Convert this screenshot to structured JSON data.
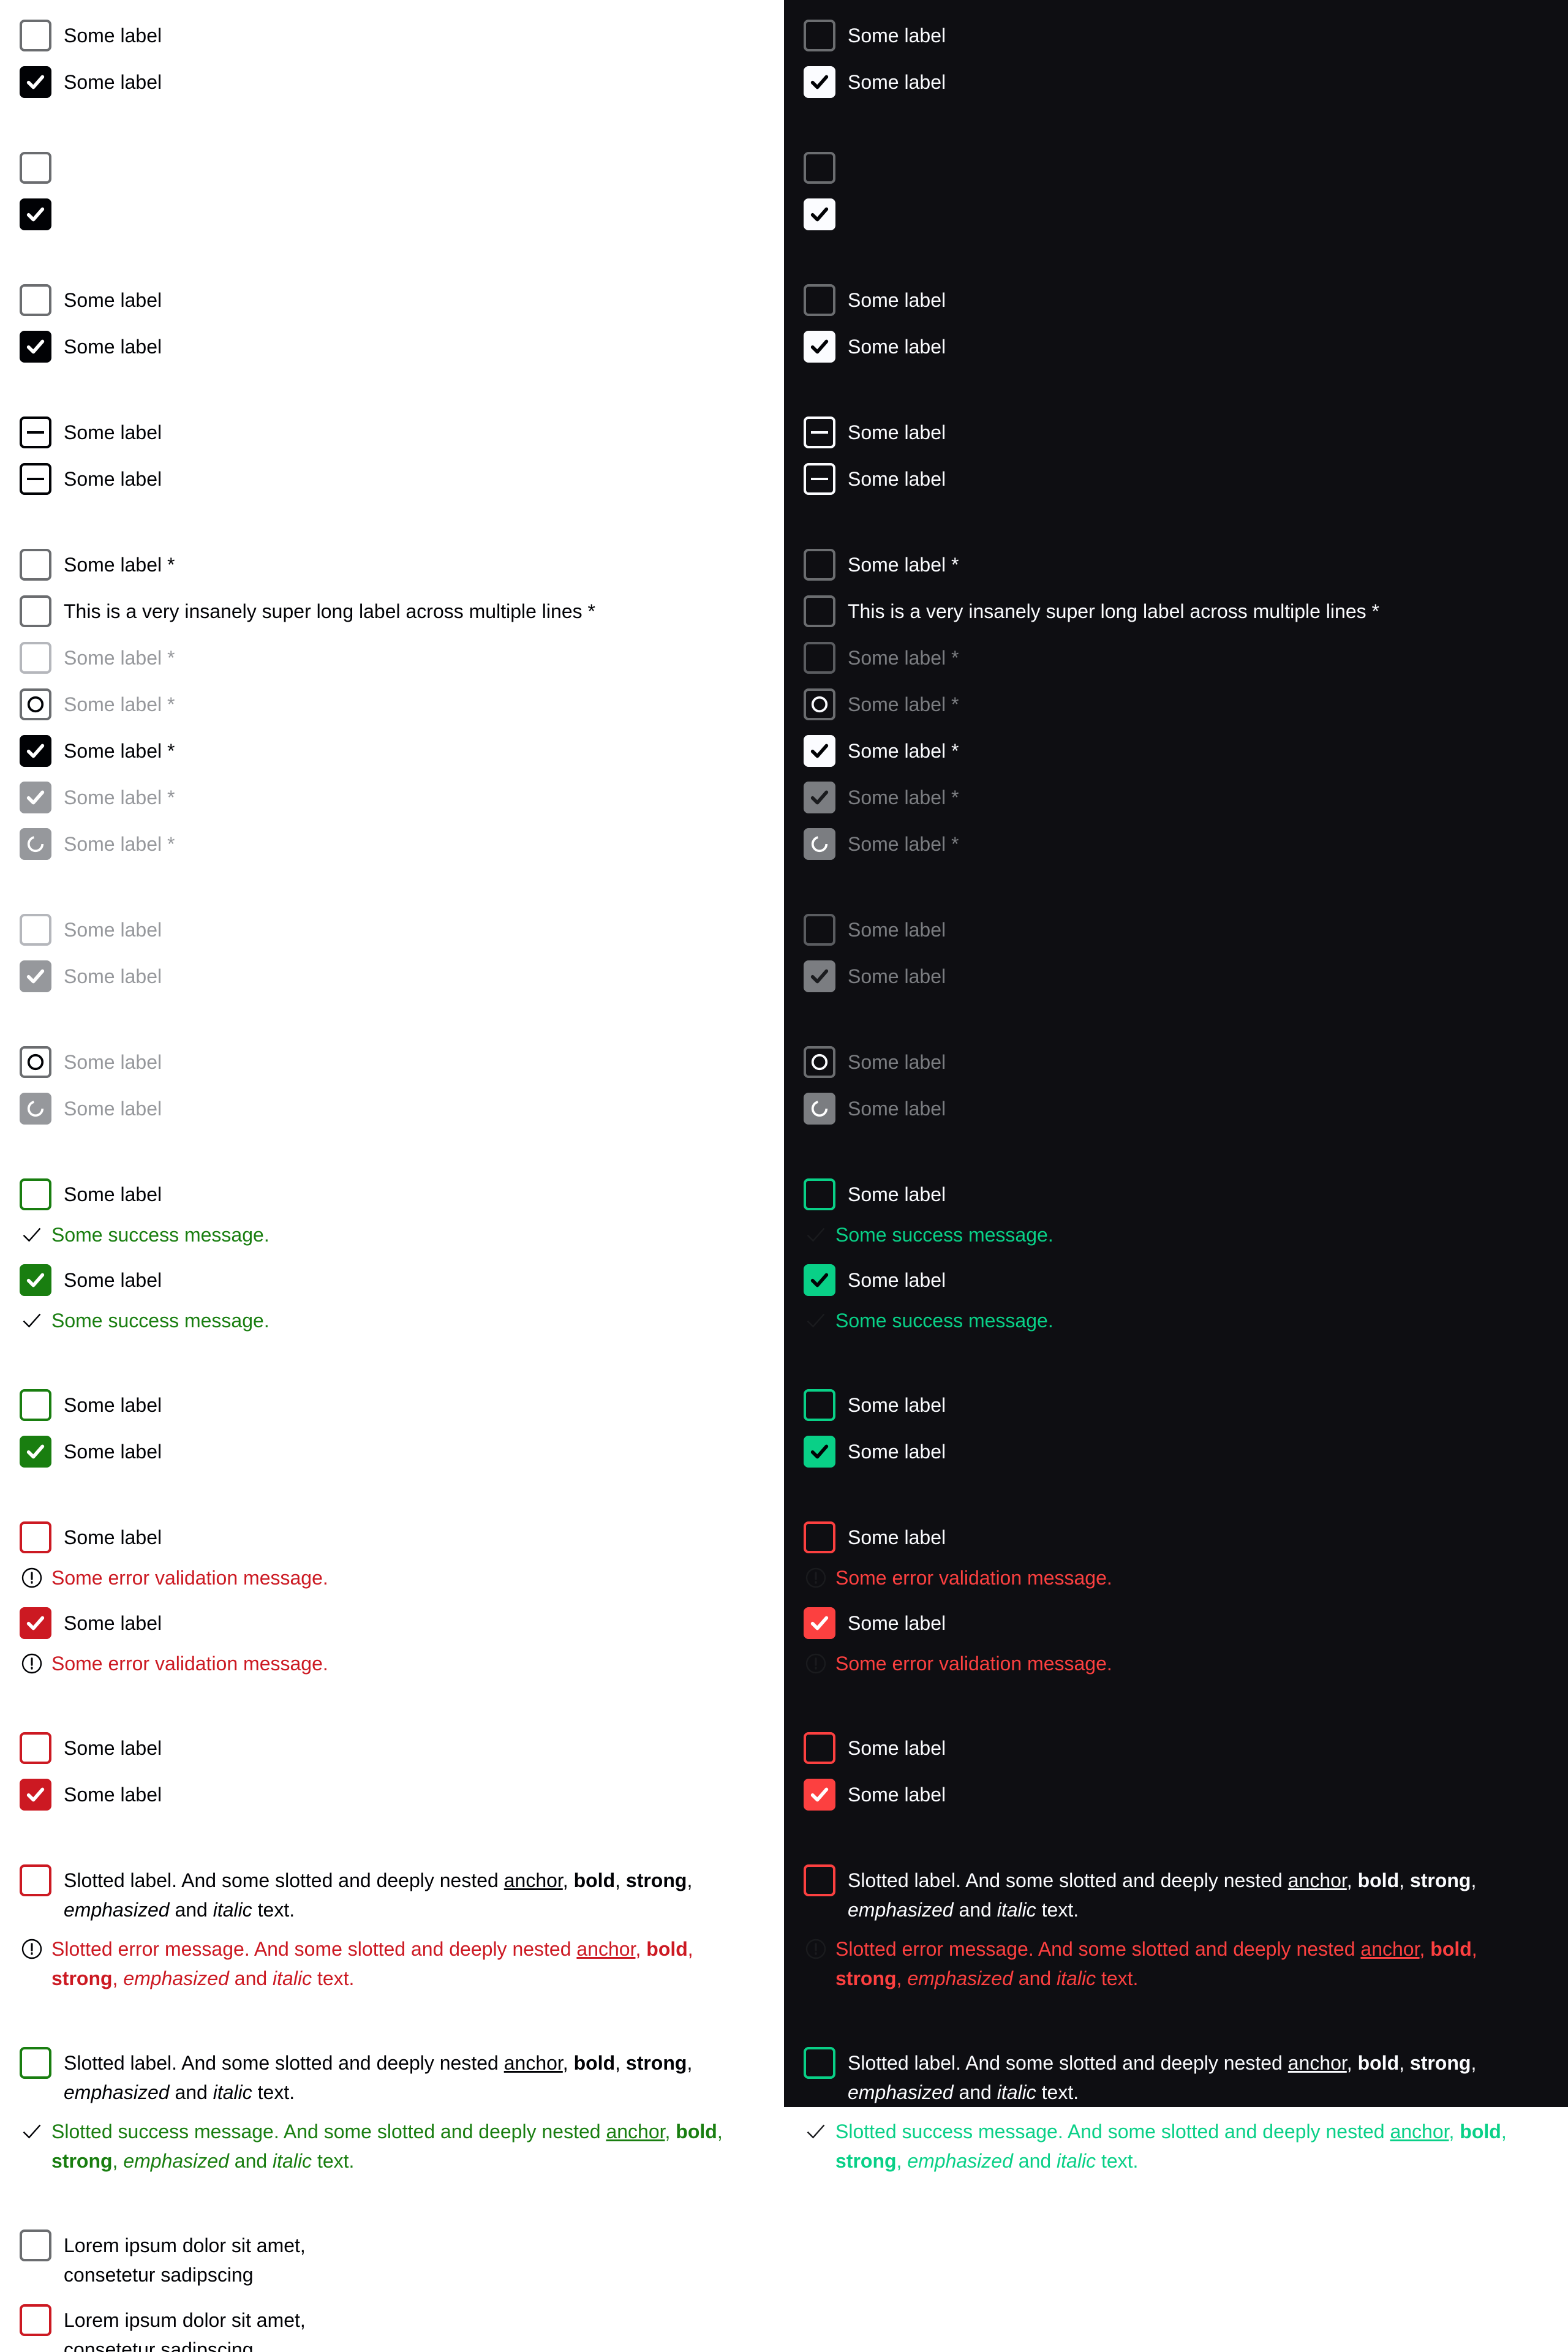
{
  "texts": {
    "some_label": "Some label",
    "some_label_req": "Some label *",
    "long_label_req": "This is a very insanely super long label across multiple lines *",
    "success_msg": "Some success message.",
    "error_msg": "Some error validation message.",
    "slotted_label_pre": "Slotted label. And some slotted and deeply nested ",
    "slotted_error_pre": "Slotted error message. And some slotted and deeply nested ",
    "slotted_success_pre": "Slotted success message. And some slotted and deeply nested ",
    "anchor": "anchor",
    "comma": ", ",
    "bold": "bold",
    "strong": "strong",
    "emphasized": "emphasized",
    "and": " and ",
    "italic": "italic",
    "text_end": " text.",
    "lorem": "Lorem ipsum dolor sit amet, consetetur sadipscing"
  },
  "colors": {
    "light_bg": "#ffffff",
    "dark_bg": "#0e0e12",
    "success_light": "#197e10",
    "success_dark": "#09d087",
    "error_light": "#cc1922",
    "error_dark": "#fc4040"
  },
  "icons": [
    "check-icon",
    "indeterminate-icon",
    "spinner-icon",
    "success-check-icon",
    "error-exclamation-icon"
  ]
}
